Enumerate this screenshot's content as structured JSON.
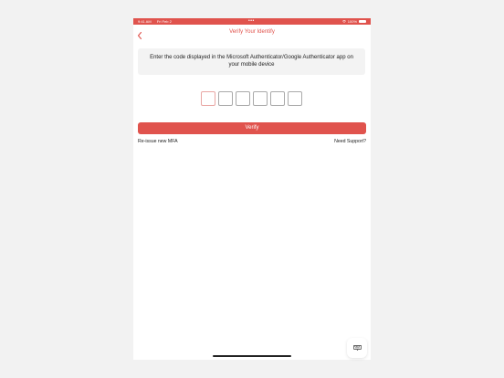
{
  "status_bar": {
    "time": "9:41 AM",
    "date": "Fri Feb 2",
    "dots": "•••",
    "battery": "100%",
    "icons": [
      "wifi-icon",
      "battery-icon"
    ],
    "background_color": "#e0534d"
  },
  "nav": {
    "title": "Verify Your Identify",
    "back_icon": "chevron-left-icon"
  },
  "instructions": {
    "text": "Enter the code displayed in the Microsoft Authenticator/Google Authenticator app on your mobile device"
  },
  "code_input": {
    "length": 6,
    "values": [
      "",
      "",
      "",
      "",
      "",
      ""
    ],
    "active_index": 0
  },
  "verify_button": {
    "label": "Verify"
  },
  "links": {
    "reissue": "Re-issue new MFA",
    "support": "Need Support?"
  },
  "colors": {
    "accent": "#e0534d",
    "box_border": "#a9a9a9",
    "active_box_border": "#e9a6a3",
    "background": "#f2f2f2"
  },
  "keyboard_button": {
    "icon": "keyboard-dismiss-icon"
  }
}
